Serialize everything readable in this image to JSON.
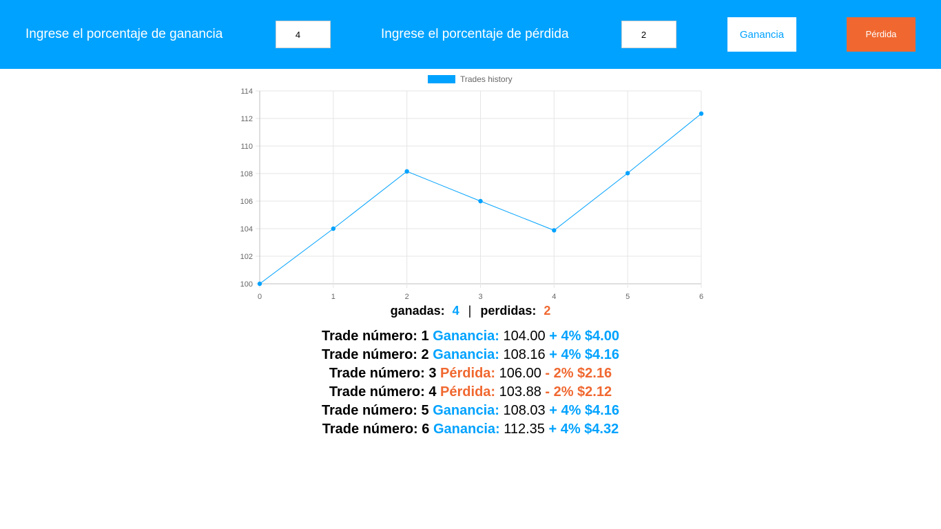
{
  "header": {
    "gain_label": "Ingrese el porcentaje de ganancia",
    "gain_value": "4",
    "loss_label": "Ingrese el porcentaje de pérdida",
    "loss_value": "2",
    "gain_button": "Ganancia",
    "loss_button": "Pérdida"
  },
  "colors": {
    "primary": "#00a2ff",
    "loss": "#f06830"
  },
  "chart_data": {
    "type": "line",
    "legend": "top-center",
    "x": [
      0,
      1,
      2,
      3,
      4,
      5,
      6
    ],
    "series": [
      {
        "name": "Trades history",
        "values": [
          100,
          104,
          108.16,
          106,
          103.88,
          108.03,
          112.35
        ]
      }
    ],
    "ylim": [
      100,
      114
    ],
    "yticks": [
      100,
      102,
      104,
      106,
      108,
      110,
      112,
      114
    ],
    "xticks": [
      0,
      1,
      2,
      3,
      4,
      5,
      6
    ],
    "grid": true
  },
  "summary": {
    "won_label": "ganadas:",
    "won_count": "4",
    "separator": "|",
    "lost_label": "perdidas:",
    "lost_count": "2"
  },
  "trades": [
    {
      "prefix": "Trade número: 1",
      "type": "Ganancia:",
      "value": "104.00",
      "change": "+ 4% $4.00",
      "kind": "gain"
    },
    {
      "prefix": "Trade número: 2",
      "type": "Ganancia:",
      "value": "108.16",
      "change": "+ 4% $4.16",
      "kind": "gain"
    },
    {
      "prefix": "Trade número: 3",
      "type": "Pérdida:",
      "value": "106.00",
      "change": "- 2% $2.16",
      "kind": "loss"
    },
    {
      "prefix": "Trade número: 4",
      "type": "Pérdida:",
      "value": "103.88",
      "change": "- 2% $2.12",
      "kind": "loss"
    },
    {
      "prefix": "Trade número: 5",
      "type": "Ganancia:",
      "value": "108.03",
      "change": "+ 4% $4.16",
      "kind": "gain"
    },
    {
      "prefix": "Trade número: 6",
      "type": "Ganancia:",
      "value": "112.35",
      "change": "+ 4% $4.32",
      "kind": "gain"
    }
  ]
}
